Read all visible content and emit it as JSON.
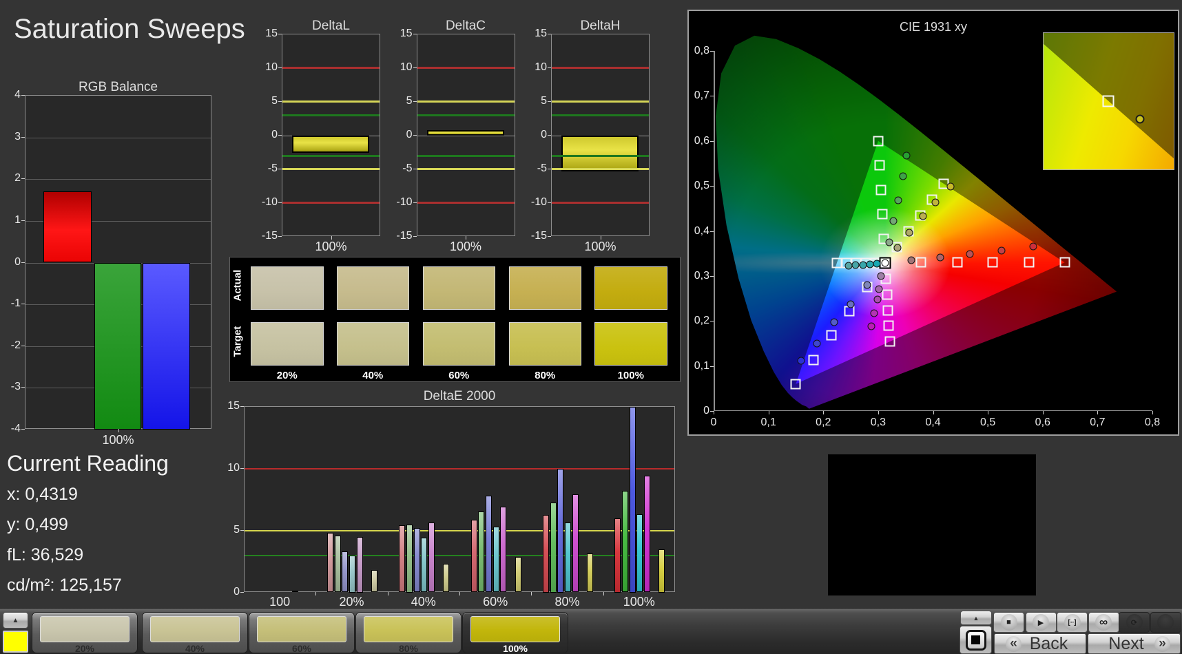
{
  "page": {
    "title": "Saturation Sweeps"
  },
  "chart_data": [
    {
      "id": "rgb_balance",
      "type": "bar",
      "title": "RGB Balance",
      "xlabel": "100%",
      "categories": [
        "Red",
        "Green",
        "Blue"
      ],
      "values": [
        1.7,
        -4.0,
        -4.0
      ],
      "colors": [
        "#f01414",
        "#1f9a1f",
        "#2525ef"
      ],
      "ylim": [
        -4,
        4
      ],
      "yticks": [
        "4",
        "3",
        "2",
        "1",
        "0",
        "-1",
        "-2",
        "-3",
        "-4"
      ]
    },
    {
      "id": "delta_l",
      "type": "bar",
      "title": "DeltaL",
      "xlabel": "100%",
      "categories": [
        "100%"
      ],
      "values": [
        -2.6
      ],
      "bar_color": "#d8d22c",
      "ylim": [
        -15,
        15
      ],
      "yticks": [
        "15",
        "10",
        "5",
        "0",
        "-5",
        "-10",
        "-15"
      ],
      "thresholds": [
        {
          "value": 10,
          "color": "#ab2f2f"
        },
        {
          "value": 5,
          "color": "#d6d657"
        },
        {
          "value": 3,
          "color": "#1e781e"
        },
        {
          "value": -3,
          "color": "#1e781e"
        },
        {
          "value": -5,
          "color": "#d6d657"
        },
        {
          "value": -10,
          "color": "#ab2f2f"
        }
      ]
    },
    {
      "id": "delta_c",
      "type": "bar",
      "title": "DeltaC",
      "xlabel": "100%",
      "categories": [
        "100%"
      ],
      "values": [
        0.8
      ],
      "bar_color": "#d8d22c",
      "ylim": [
        -15,
        15
      ],
      "yticks": [
        "15",
        "10",
        "5",
        "0",
        "-5",
        "-10",
        "-15"
      ],
      "thresholds": [
        {
          "value": 10,
          "color": "#ab2f2f"
        },
        {
          "value": 5,
          "color": "#d6d657"
        },
        {
          "value": 3,
          "color": "#1e781e"
        },
        {
          "value": -3,
          "color": "#1e781e"
        },
        {
          "value": -5,
          "color": "#d6d657"
        },
        {
          "value": -10,
          "color": "#ab2f2f"
        }
      ]
    },
    {
      "id": "delta_h",
      "type": "bar",
      "title": "DeltaH",
      "xlabel": "100%",
      "categories": [
        "100%"
      ],
      "values": [
        -5.3
      ],
      "bar_color": "#d8d22c",
      "ylim": [
        -15,
        15
      ],
      "yticks": [
        "15",
        "10",
        "5",
        "0",
        "-5",
        "-10",
        "-15"
      ],
      "thresholds": [
        {
          "value": 10,
          "color": "#ab2f2f"
        },
        {
          "value": 5,
          "color": "#d6d657"
        },
        {
          "value": 3,
          "color": "#1e781e"
        },
        {
          "value": -3,
          "color": "#1e781e"
        },
        {
          "value": -5,
          "color": "#d6d657"
        },
        {
          "value": -10,
          "color": "#ab2f2f"
        }
      ]
    },
    {
      "id": "deltae2000",
      "type": "grouped-bar",
      "title": "DeltaE 2000",
      "categories": [
        "100",
        "20%",
        "40%",
        "60%",
        "80%",
        "100%"
      ],
      "series_order": [
        "red",
        "green",
        "blue",
        "cyan",
        "magenta",
        "white",
        "yellow"
      ],
      "groups": [
        {
          "label": "100",
          "values": [
            0,
            0,
            0,
            0,
            0,
            0.15,
            0
          ],
          "colors": [
            "#cf9598",
            "#a6bd9b",
            "#9193c9",
            "#94c3c6",
            "#c498c7",
            "#e2e2e2",
            "#cdc9a2"
          ]
        },
        {
          "label": "20%",
          "values": [
            4.8,
            4.6,
            3.3,
            3.0,
            4.5,
            0,
            1.8
          ],
          "colors": [
            "#cf9598",
            "#a6bd9b",
            "#9193c9",
            "#94c3c6",
            "#c498c7",
            "#e2e2e2",
            "#cdc9a2"
          ]
        },
        {
          "label": "40%",
          "values": [
            5.4,
            5.5,
            5.2,
            4.4,
            5.65,
            0,
            2.3
          ],
          "colors": [
            "#d07b80",
            "#8fbc85",
            "#8286cd",
            "#7fc3c8",
            "#c77fc9",
            "#e2e2e2",
            "#cfca8a"
          ]
        },
        {
          "label": "60%",
          "values": [
            5.85,
            6.55,
            7.8,
            5.3,
            6.9,
            0,
            2.85
          ],
          "colors": [
            "#d2626a",
            "#76bb6e",
            "#7277d2",
            "#66c3cb",
            "#ca64cc",
            "#e2e2e2",
            "#d1cb71"
          ]
        },
        {
          "label": "80%",
          "values": [
            6.25,
            7.25,
            10.0,
            5.65,
            7.9,
            0,
            3.15
          ],
          "colors": [
            "#d4484f",
            "#5cba55",
            "#5f65d8",
            "#4cc3cd",
            "#cd48ce",
            "#e2e2e2",
            "#d3cc56"
          ]
        },
        {
          "label": "100%",
          "values": [
            6.0,
            8.2,
            16.0,
            6.3,
            9.4,
            0,
            3.5
          ],
          "colors": [
            "#d62e35",
            "#3fb93a",
            "#4450de",
            "#2fc3d0",
            "#d02cd1",
            "#e2e2e2",
            "#d5cd3a"
          ]
        }
      ],
      "ylim": [
        0,
        15
      ],
      "yticks": [
        "0",
        "5",
        "10",
        "15"
      ],
      "thresholds": [
        {
          "value": 10,
          "color": "#b92b2b"
        },
        {
          "value": 5,
          "color": "#d6d64d"
        },
        {
          "value": 3,
          "color": "#24821f"
        }
      ]
    },
    {
      "id": "cie",
      "type": "scatter",
      "title": "CIE 1931 xy",
      "xlim": [
        0,
        0.8
      ],
      "ylim": [
        0,
        0.8
      ],
      "xtick_labels": [
        "0",
        "0,1",
        "0,2",
        "0,3",
        "0,4",
        "0,5",
        "0,6",
        "0,7",
        "0,8"
      ],
      "ytick_labels": [
        "0",
        "0,1",
        "0,2",
        "0,3",
        "0,4",
        "0,5",
        "0,6",
        "0,7",
        "0,8"
      ],
      "gamut_triangle": {
        "red": [
          0.64,
          0.33
        ],
        "green": [
          0.3,
          0.6
        ],
        "blue": [
          0.15,
          0.06
        ]
      },
      "white_point": {
        "x": 0.3127,
        "y": 0.329
      },
      "targets": {
        "red": [
          [
            0.378,
            0.33
          ],
          [
            0.444,
            0.33
          ],
          [
            0.509,
            0.33
          ],
          [
            0.575,
            0.33
          ],
          [
            0.64,
            0.33
          ]
        ],
        "green": [
          [
            0.3102,
            0.3832
          ],
          [
            0.3076,
            0.4374
          ],
          [
            0.3051,
            0.4916
          ],
          [
            0.3025,
            0.5458
          ],
          [
            0.3,
            0.6
          ]
        ],
        "blue": [
          [
            0.28,
            0.2752
          ],
          [
            0.2475,
            0.2214
          ],
          [
            0.215,
            0.1676
          ],
          [
            0.1825,
            0.1138
          ],
          [
            0.15,
            0.06
          ]
        ],
        "cyan": [
          [
            0.2951,
            0.329
          ],
          [
            0.2775,
            0.329
          ],
          [
            0.2599,
            0.329
          ],
          [
            0.2423,
            0.329
          ],
          [
            0.2246,
            0.329
          ]
        ],
        "magenta": [
          [
            0.3143,
            0.294
          ],
          [
            0.316,
            0.259
          ],
          [
            0.3176,
            0.2241
          ],
          [
            0.3193,
            0.1891
          ],
          [
            0.3209,
            0.1542
          ]
        ],
        "yellow": [
          [
            0.334,
            0.3643
          ],
          [
            0.3553,
            0.3996
          ],
          [
            0.3767,
            0.4348
          ],
          [
            0.398,
            0.4701
          ],
          [
            0.4193,
            0.5053
          ]
        ]
      },
      "measured": {
        "red": {
          "points": [
            [
              0.361,
              0.335
            ],
            [
              0.413,
              0.341
            ],
            [
              0.467,
              0.349
            ],
            [
              0.525,
              0.357
            ],
            [
              0.583,
              0.365
            ]
          ],
          "fills": [
            "#a17477",
            "#ad6468",
            "#b85359",
            "#c2414a",
            "#cd2f3a"
          ]
        },
        "green": {
          "points": [
            [
              0.32,
              0.375
            ],
            [
              0.328,
              0.422
            ],
            [
              0.337,
              0.468
            ],
            [
              0.345,
              0.522
            ],
            [
              0.352,
              0.568
            ]
          ],
          "fills": [
            "#8caa8b",
            "#73a875",
            "#58a55e",
            "#3ea348",
            "#27a032"
          ]
        },
        "blue": {
          "points": [
            [
              0.2806,
              0.2805
            ],
            [
              0.2497,
              0.2366
            ],
            [
              0.2194,
              0.1981
            ],
            [
              0.1879,
              0.1499
            ],
            [
              0.1596,
              0.1118
            ]
          ],
          "fills": [
            "#7f86b9",
            "#6a71c0",
            "#545cc7",
            "#3f46ce",
            "#2a31d5"
          ]
        },
        "cyan": {
          "points": [
            [
              0.246,
              0.3235
            ],
            [
              0.259,
              0.3245
            ],
            [
              0.272,
              0.324
            ],
            [
              0.285,
              0.326
            ],
            [
              0.297,
              0.327
            ]
          ],
          "fills": [
            "#55a6a4",
            "#46a6a7",
            "#37a7ab",
            "#28a7ae",
            "#1aa8b2"
          ]
        },
        "magenta": {
          "points": [
            [
              0.3047,
              0.2993
            ],
            [
              0.3013,
              0.2713
            ],
            [
              0.2985,
              0.2484
            ],
            [
              0.2926,
              0.2178
            ],
            [
              0.2875,
              0.1876
            ]
          ],
          "fills": [
            "#9d7fa7",
            "#a566ab",
            "#ac4daf",
            "#b434b3",
            "#bc1bb7"
          ]
        },
        "yellow": {
          "points": [
            [
              0.3348,
              0.3625
            ],
            [
              0.3563,
              0.3956
            ],
            [
              0.3821,
              0.4326
            ],
            [
              0.4042,
              0.464
            ],
            [
              0.4319,
              0.499
            ]
          ],
          "fills": [
            "#aaa47c",
            "#b1a967",
            "#b9ae52",
            "#c0b43d",
            "#c8b928"
          ]
        },
        "white": {
          "points": [
            [
              0.3127,
              0.329
            ]
          ],
          "fills": [
            "#ffffff"
          ]
        }
      }
    }
  ],
  "swatch_table": {
    "row_labels": [
      "Actual",
      "Target"
    ],
    "column_labels": [
      "20%",
      "40%",
      "60%",
      "80%",
      "100%"
    ],
    "actual_colors": [
      "#c7c2a9",
      "#c6bb8d",
      "#c3b775",
      "#c6b052",
      "#c3ac0f"
    ],
    "target_colors": [
      "#c6c2a2",
      "#c5c08c",
      "#c3bd71",
      "#c7bf52",
      "#cac20f"
    ]
  },
  "current_reading": {
    "heading": "Current Reading",
    "lines": [
      "x: 0,4319",
      "y: 0,499",
      "fL: 36,529",
      "cd/m²: 125,157"
    ]
  },
  "pattern_bar": {
    "expand_icon": "▲",
    "current_color": "#ffff00",
    "buttons": [
      {
        "label": "20%",
        "color": "#c9c6ad",
        "selected": false
      },
      {
        "label": "40%",
        "color": "#c9c495",
        "selected": false
      },
      {
        "label": "60%",
        "color": "#c5bf79",
        "selected": false
      },
      {
        "label": "80%",
        "color": "#c9c258",
        "selected": false
      },
      {
        "label": "100%",
        "color": "#c2b60b",
        "selected": true
      }
    ]
  },
  "transport": {
    "expand_icon": "▲",
    "buttons": [
      {
        "name": "stop",
        "glyph": "■",
        "enabled": true
      },
      {
        "name": "play",
        "glyph": "▶",
        "enabled": true
      },
      {
        "name": "step",
        "glyph": "[∙∙]",
        "enabled": true
      },
      {
        "name": "loop",
        "glyph": "∞",
        "enabled": true
      },
      {
        "name": "refresh",
        "glyph": "⟳",
        "enabled": false
      },
      {
        "name": "extra",
        "glyph": "",
        "enabled": false
      }
    ]
  },
  "nav": {
    "back_icon": "«",
    "back_label": "Back",
    "next_label": "Next",
    "next_icon": "»"
  }
}
